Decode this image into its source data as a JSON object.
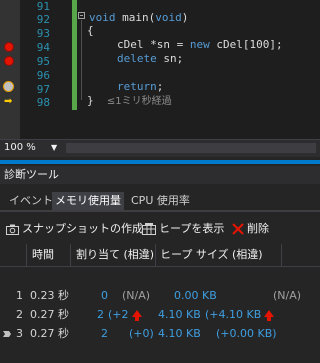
{
  "editor": {
    "line_numbers": [
      "91",
      "92",
      "93",
      "94",
      "95",
      "96",
      "97",
      "98"
    ],
    "lines": {
      "l92_kw": "void",
      "l92_rest": " main(",
      "l92_kw2": "void",
      "l92_end": ")",
      "l93": "{",
      "l94_rest": "cDel *sn = ",
      "l94_kw": "new",
      "l94_end": " cDel[100];",
      "l95_kw": "delete",
      "l95_end": " sn;",
      "l97_kw": "return",
      "l97_end": ";",
      "l98": "}",
      "l98_perf": "≤1ミリ秒経過"
    }
  },
  "zoom": {
    "value": "100 %"
  },
  "panel": {
    "title": "診断ツール",
    "tabs": [
      "イベント",
      "メモリ使用量",
      "CPU 使用率"
    ],
    "active_tab": "メモリ使用量",
    "toolbar": {
      "snapshot": "スナップショットの作成",
      "show_heap": "ヒープを表示",
      "delete": "削除"
    },
    "columns": [
      "時間",
      "割り当て (相違)",
      "ヒープ サイズ (相違)"
    ],
    "rows": [
      {
        "id": "1",
        "time": "0.23 秒",
        "alloc": "0",
        "alloc_diff": "(N/A)",
        "heap": "0.00 KB",
        "heap_diff": "(N/A)"
      },
      {
        "id": "2",
        "time": "0.27 秒",
        "alloc": "2",
        "alloc_diff": "(+2",
        "heap": "4.10 KB",
        "heap_diff": "(+4.10 KB"
      },
      {
        "id": "3",
        "time": "0.27 秒",
        "alloc": "2",
        "alloc_diff": "(+0)",
        "heap": "4.10 KB",
        "heap_diff": "(+0.00 KB)"
      }
    ]
  },
  "colors": {
    "accent": "#007acc",
    "breakpoint": "#e51400",
    "number": "#3f9ee0",
    "increase": "#e51400"
  }
}
